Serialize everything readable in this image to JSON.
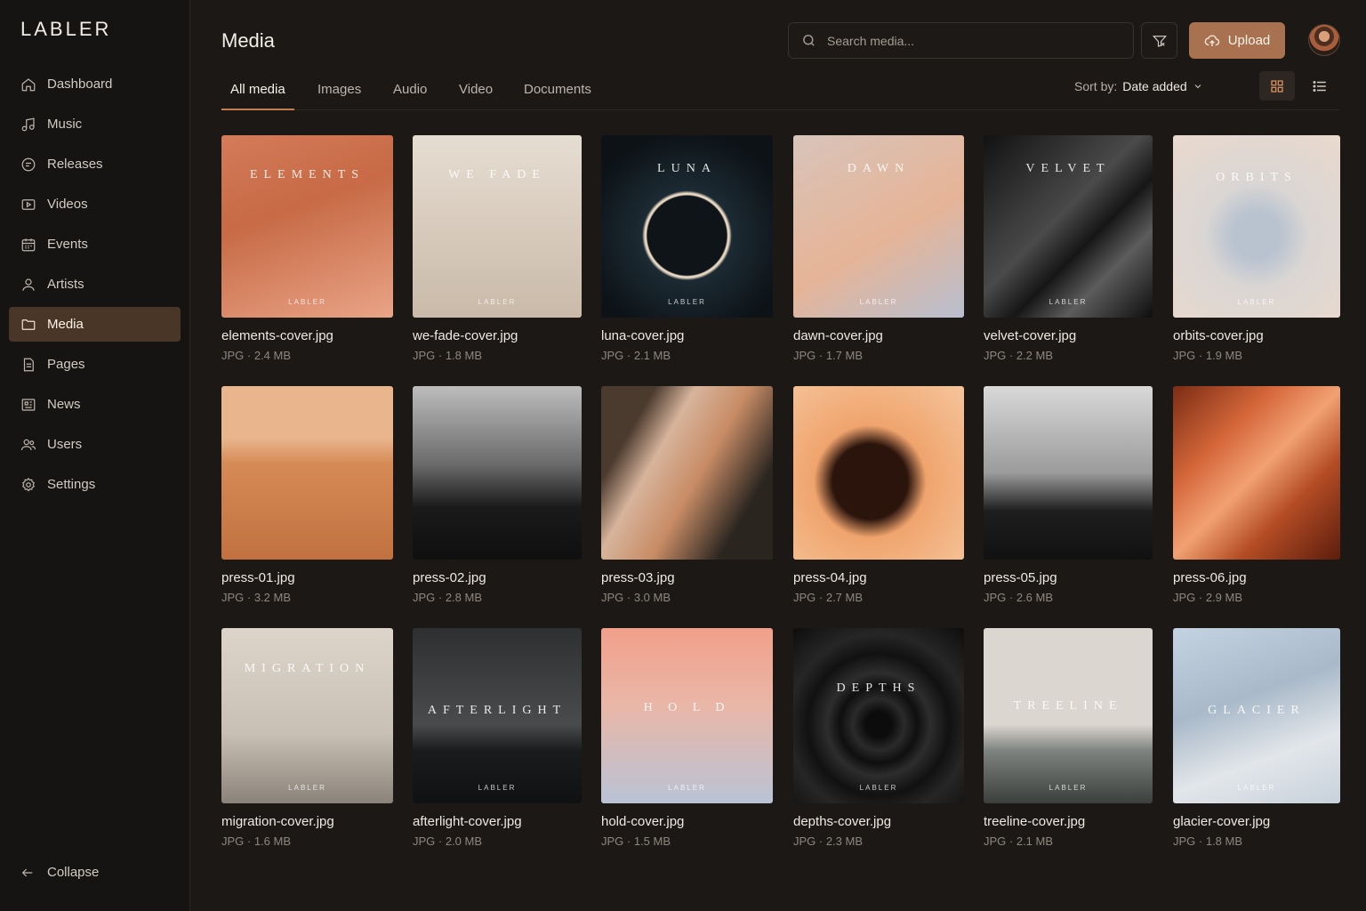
{
  "sidebar": {
    "logo": "LABLER",
    "items": [
      {
        "label": "Dashboard",
        "icon": "home-icon"
      },
      {
        "label": "Music",
        "icon": "music-note-icon"
      },
      {
        "label": "Releases",
        "icon": "disc-icon"
      },
      {
        "label": "Videos",
        "icon": "video-icon"
      },
      {
        "label": "Events",
        "icon": "calendar-icon"
      },
      {
        "label": "Artists",
        "icon": "user-icon"
      },
      {
        "label": "Media",
        "icon": "folder-icon",
        "active": true
      },
      {
        "label": "Pages",
        "icon": "page-icon"
      },
      {
        "label": "News",
        "icon": "newspaper-icon"
      },
      {
        "label": "Users",
        "icon": "users-icon"
      },
      {
        "label": "Settings",
        "icon": "gear-icon"
      }
    ],
    "collapse_label": "Collapse"
  },
  "header": {
    "title": "Media",
    "search_placeholder": "Search media...",
    "upload_label": "Upload"
  },
  "tabs": [
    {
      "label": "All media",
      "active": true
    },
    {
      "label": "Images"
    },
    {
      "label": "Audio"
    },
    {
      "label": "Video"
    },
    {
      "label": "Documents"
    }
  ],
  "sort": {
    "label": "Sort by:",
    "value": "Date added"
  },
  "view_mode": "grid",
  "accent_color": "#a8714f",
  "media": [
    {
      "name": "elements-cover.jpg",
      "meta": "JPG · 2.4 MB",
      "title": "ELEMENTS",
      "brand": "LABLER"
    },
    {
      "name": "we-fade-cover.jpg",
      "meta": "JPG · 1.8 MB",
      "title": "WE FADE",
      "brand": "LABLER"
    },
    {
      "name": "luna-cover.jpg",
      "meta": "JPG · 2.1 MB",
      "title": "LUNA",
      "brand": "LABLER"
    },
    {
      "name": "dawn-cover.jpg",
      "meta": "JPG · 1.7 MB",
      "title": "DAWN",
      "brand": "LABLER"
    },
    {
      "name": "velvet-cover.jpg",
      "meta": "JPG · 2.2 MB",
      "title": "VELVET",
      "brand": "LABLER"
    },
    {
      "name": "orbits-cover.jpg",
      "meta": "JPG · 1.9 MB",
      "title": "ORBITS",
      "brand": "LABLER"
    },
    {
      "name": "press-01.jpg",
      "meta": "JPG · 3.2 MB",
      "title": "",
      "brand": ""
    },
    {
      "name": "press-02.jpg",
      "meta": "JPG · 2.8 MB",
      "title": "",
      "brand": ""
    },
    {
      "name": "press-03.jpg",
      "meta": "JPG · 3.0 MB",
      "title": "",
      "brand": ""
    },
    {
      "name": "press-04.jpg",
      "meta": "JPG · 2.7 MB",
      "title": "",
      "brand": ""
    },
    {
      "name": "press-05.jpg",
      "meta": "JPG · 2.6 MB",
      "title": "",
      "brand": ""
    },
    {
      "name": "press-06.jpg",
      "meta": "JPG · 2.9 MB",
      "title": "",
      "brand": ""
    },
    {
      "name": "migration-cover.jpg",
      "meta": "JPG · 1.6 MB",
      "title": "MIGRATION",
      "brand": "LABLER"
    },
    {
      "name": "afterlight-cover.jpg",
      "meta": "JPG · 2.0 MB",
      "title": "AFTERLIGHT",
      "brand": "LABLER"
    },
    {
      "name": "hold-cover.jpg",
      "meta": "JPG · 1.5 MB",
      "title": "H O L D",
      "brand": "LABLER"
    },
    {
      "name": "depths-cover.jpg",
      "meta": "JPG · 2.3 MB",
      "title": "DEPTHS",
      "brand": "LABLER"
    },
    {
      "name": "treeline-cover.jpg",
      "meta": "JPG · 2.1 MB",
      "title": "TREELINE",
      "brand": "LABLER"
    },
    {
      "name": "glacier-cover.jpg",
      "meta": "JPG · 1.8 MB",
      "title": "GLACIER",
      "brand": "LABLER"
    }
  ]
}
